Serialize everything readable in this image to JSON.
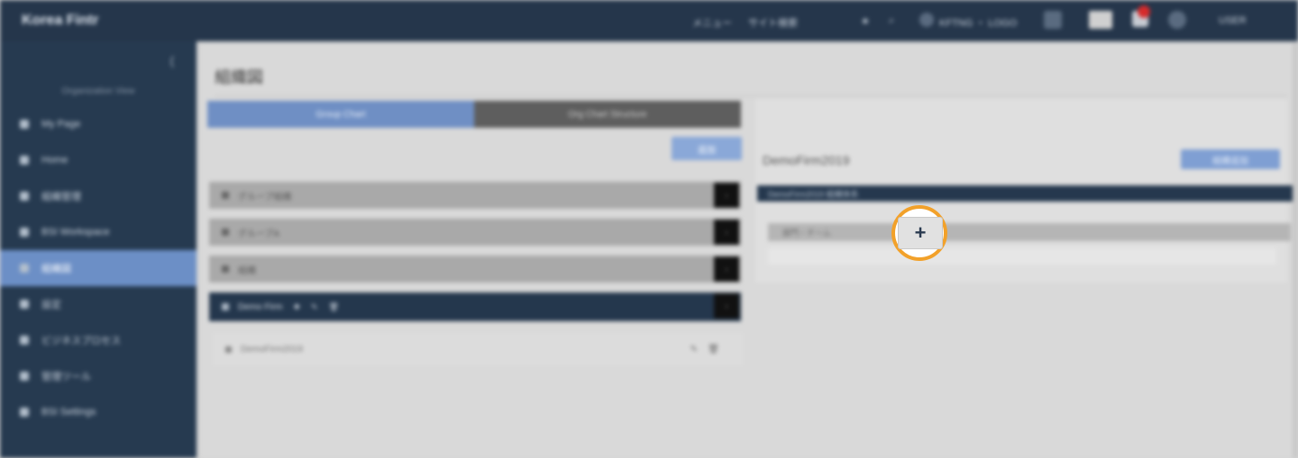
{
  "app": {
    "title": "Korea Fintr"
  },
  "topbar": {
    "menu_label": "メニュー",
    "search_placeholder": "サイト検索",
    "user_org": "KFTNG ・ LOGO",
    "user_name": "USER",
    "icons": [
      "star-icon",
      "search-icon",
      "globe-icon",
      "house-icon",
      "flag-icon",
      "bell-icon",
      "help-icon"
    ]
  },
  "sidebar": {
    "collapse_icon": "chevron-left-icon",
    "org_label": "Organization View",
    "items": [
      {
        "label": "My Page"
      },
      {
        "label": "Home"
      },
      {
        "label": "組織管理"
      },
      {
        "label": "BSI Workspace"
      },
      {
        "label": "組織図"
      },
      {
        "label": "設定"
      },
      {
        "label": "ビジネスプロセス"
      },
      {
        "label": "管理ツール"
      },
      {
        "label": "BSI Settings"
      }
    ],
    "active_index": 4
  },
  "page": {
    "title": "組織図"
  },
  "tabs": [
    {
      "label": "Group Chart"
    },
    {
      "label": "Org Chart Structure"
    }
  ],
  "left": {
    "add_button": "追加",
    "rows": [
      {
        "label": "グループ組織"
      },
      {
        "label": "グループA"
      },
      {
        "label": "組織"
      },
      {
        "label": "Demo Firm"
      }
    ],
    "sub_row": {
      "label": "DemoFirm2019"
    }
  },
  "right": {
    "title": "DemoFirm2019",
    "add_button": "組織追加",
    "header_label": "DemoFirm2019 組織体系",
    "row_label": "部門・チーム"
  },
  "focus": {
    "label": "+"
  }
}
